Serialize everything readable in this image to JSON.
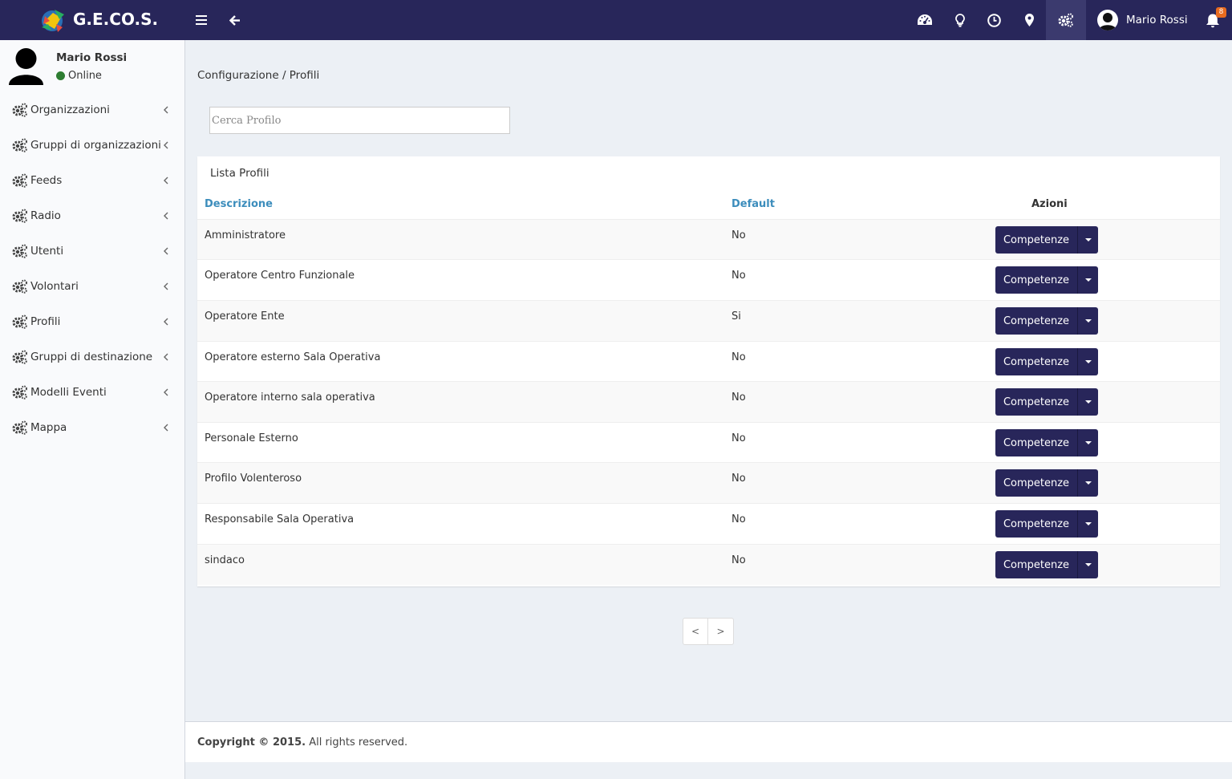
{
  "app": {
    "title": "G.E.CO.S."
  },
  "topbar": {
    "user_name": "Mario Rossi",
    "notification_count": "8",
    "icons": [
      "dashboard-icon",
      "lightbulb-icon",
      "clock-icon",
      "map-marker-icon",
      "gears-icon"
    ]
  },
  "sidebar": {
    "user_name": "Mario Rossi",
    "status": "Online",
    "items": [
      {
        "label": "Organizzazioni"
      },
      {
        "label": "Gruppi di organizzazioni"
      },
      {
        "label": "Feeds"
      },
      {
        "label": "Radio"
      },
      {
        "label": "Utenti"
      },
      {
        "label": "Volontari"
      },
      {
        "label": "Profili"
      },
      {
        "label": "Gruppi di destinazione"
      },
      {
        "label": "Modelli Eventi"
      },
      {
        "label": "Mappa"
      }
    ]
  },
  "main": {
    "breadcrumb": "Configurazione / Profili",
    "search_placeholder": "Cerca Profilo",
    "box_title": "Lista Profili",
    "columns": {
      "descrizione": "Descrizione",
      "default": "Default",
      "azioni": "Azioni"
    },
    "action_label": "Competenze",
    "rows": [
      {
        "descrizione": "Amministratore",
        "default": "No"
      },
      {
        "descrizione": "Operatore Centro Funzionale",
        "default": "No"
      },
      {
        "descrizione": "Operatore Ente",
        "default": "Si"
      },
      {
        "descrizione": "Operatore esterno Sala Operativa",
        "default": "No"
      },
      {
        "descrizione": "Operatore interno sala operativa",
        "default": "No"
      },
      {
        "descrizione": "Personale Esterno",
        "default": "No"
      },
      {
        "descrizione": "Profilo Volenteroso",
        "default": "No"
      },
      {
        "descrizione": "Responsabile Sala Operativa",
        "default": "No"
      },
      {
        "descrizione": "sindaco",
        "default": "No"
      }
    ],
    "pager": {
      "prev": "<",
      "next": ">"
    }
  },
  "footer": {
    "copyright_bold": "Copyright © 2015.",
    "copyright_rest": " All rights reserved."
  },
  "colors": {
    "navbar": "#28265a",
    "accent_link": "#3c8dbc",
    "status_online": "#2e7d32",
    "badge": "#e86b1f"
  }
}
